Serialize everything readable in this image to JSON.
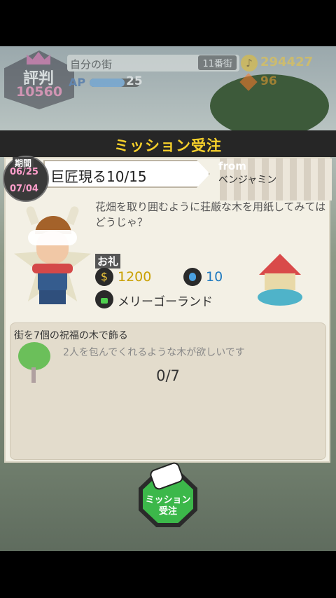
{
  "hud": {
    "reputation_label": "評判",
    "reputation_value": "10560",
    "town_name": "自分の街",
    "town_number": "11番街",
    "ap_label": "AP",
    "ap_value": "25",
    "coins": "294427",
    "gems": "96"
  },
  "modal": {
    "title": "ミッション受注",
    "period_label": "期間",
    "period_start": "06/25",
    "period_end": "07/04",
    "mission_title": "巨匠現る10/15",
    "from_label": "from",
    "from_name": "ベンジャミン",
    "description": "花畑を取り囲むように荘厳な木を用紙してみてはどうじゃ？",
    "rewards_label": "お礼",
    "reward_coins": "1200",
    "reward_potion": "10",
    "reward_unlock": "メリーゴーランド",
    "task": {
      "title": "街を7個の祝福の木で飾る",
      "subtitle": "2人を包んでくれるような木が欲しいです",
      "progress": "0/7"
    }
  },
  "accept_button": {
    "label": "ミッション\n受注"
  },
  "colors": {
    "accent_yellow": "#f6d02b",
    "accept_green": "#3cb84a",
    "period_pink": "#ff9ecb"
  }
}
